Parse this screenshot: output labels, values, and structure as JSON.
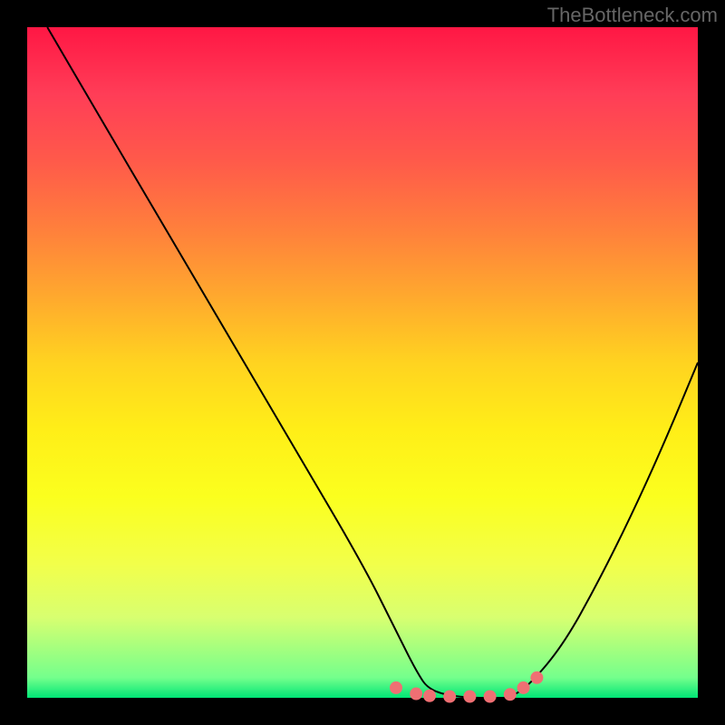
{
  "watermark": "TheBottleneck.com",
  "chart_data": {
    "type": "line",
    "title": "",
    "xlabel": "",
    "ylabel": "",
    "xlim": [
      0,
      100
    ],
    "ylim": [
      0,
      100
    ],
    "series": [
      {
        "name": "bottleneck-curve",
        "x": [
          3,
          10,
          20,
          30,
          40,
          50,
          55,
          58,
          60,
          65,
          70,
          72,
          75,
          80,
          85,
          90,
          95,
          100
        ],
        "y": [
          100,
          88,
          71,
          54,
          37,
          20,
          10,
          4,
          1,
          0,
          0,
          0,
          2,
          8,
          17,
          27,
          38,
          50
        ]
      }
    ],
    "highlight_region": {
      "name": "optimal-dots",
      "x": [
        55,
        58,
        60,
        63,
        66,
        69,
        72,
        74,
        76
      ],
      "y": [
        1.5,
        0.6,
        0.3,
        0.2,
        0.2,
        0.2,
        0.5,
        1.5,
        3
      ]
    },
    "gradient_stops": [
      {
        "pos": 0,
        "color": "#ff1744"
      },
      {
        "pos": 50,
        "color": "#ffd320"
      },
      {
        "pos": 85,
        "color": "#f2ff4a"
      },
      {
        "pos": 100,
        "color": "#00e676"
      }
    ]
  }
}
